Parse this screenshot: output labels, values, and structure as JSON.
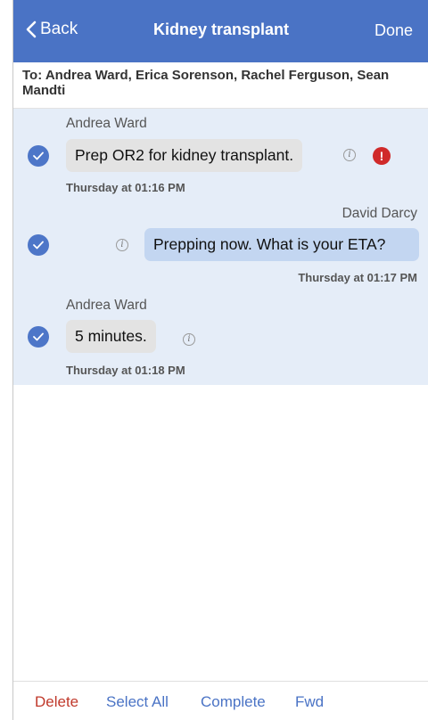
{
  "nav": {
    "back_label": "Back",
    "title": "Kidney transplant",
    "done_label": "Done"
  },
  "recipients": {
    "text": "To: Andrea Ward, Erica Sorenson, Rachel Ferguson, Sean Mandti"
  },
  "messages": [
    {
      "sender": "Andrea Ward",
      "text": "Prep OR2 for kidney transplant.",
      "timestamp": "Thursday at 01:16 PM",
      "direction": "incoming",
      "selected": true,
      "info_icon": "info-icon",
      "alert_icon": "exclamation-alert-icon"
    },
    {
      "sender": "David Darcy",
      "text": "Prepping now. What is your ETA?",
      "timestamp": "Thursday at 01:17 PM",
      "direction": "outgoing",
      "selected": true,
      "info_icon": "info-icon"
    },
    {
      "sender": "Andrea Ward",
      "text": "5 minutes.",
      "timestamp": "Thursday at 01:18 PM",
      "direction": "incoming",
      "selected": true,
      "info_icon": "info-icon"
    }
  ],
  "toolbar": {
    "delete_label": "Delete",
    "select_all_label": "Select All",
    "complete_label": "Complete",
    "fwd_label": "Fwd"
  },
  "colors": {
    "nav_bar": "#4a73c5",
    "thread_background": "#e5edf8",
    "incoming_bubble": "#e3e3e3",
    "outgoing_bubble": "#c3d6f1",
    "check": "#4d76c8",
    "alert": "#d02a2a",
    "delete": "#c0392b"
  }
}
